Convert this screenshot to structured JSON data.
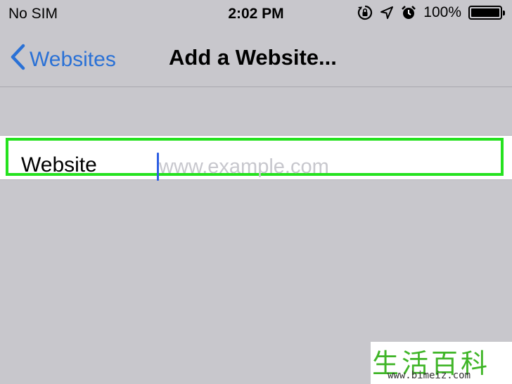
{
  "status_bar": {
    "carrier": "No SIM",
    "time": "2:02 PM",
    "battery_percent": "100%",
    "battery_level": 1.0,
    "icons": [
      "orientation-lock-icon",
      "location-arrow-icon",
      "alarm-clock-icon",
      "battery-icon"
    ]
  },
  "nav": {
    "back_label": "Websites",
    "title": "Add a Website..."
  },
  "form": {
    "field_label": "Website",
    "input_value": "",
    "input_placeholder": "www.example.com"
  },
  "colors": {
    "accent": "#2a71d6",
    "highlight": "#25e21f",
    "background": "#c8c7cc",
    "cursor": "#2e5fe3"
  },
  "watermark": {
    "glyphs": "生活百科",
    "url": "www.bimeiz.com"
  }
}
